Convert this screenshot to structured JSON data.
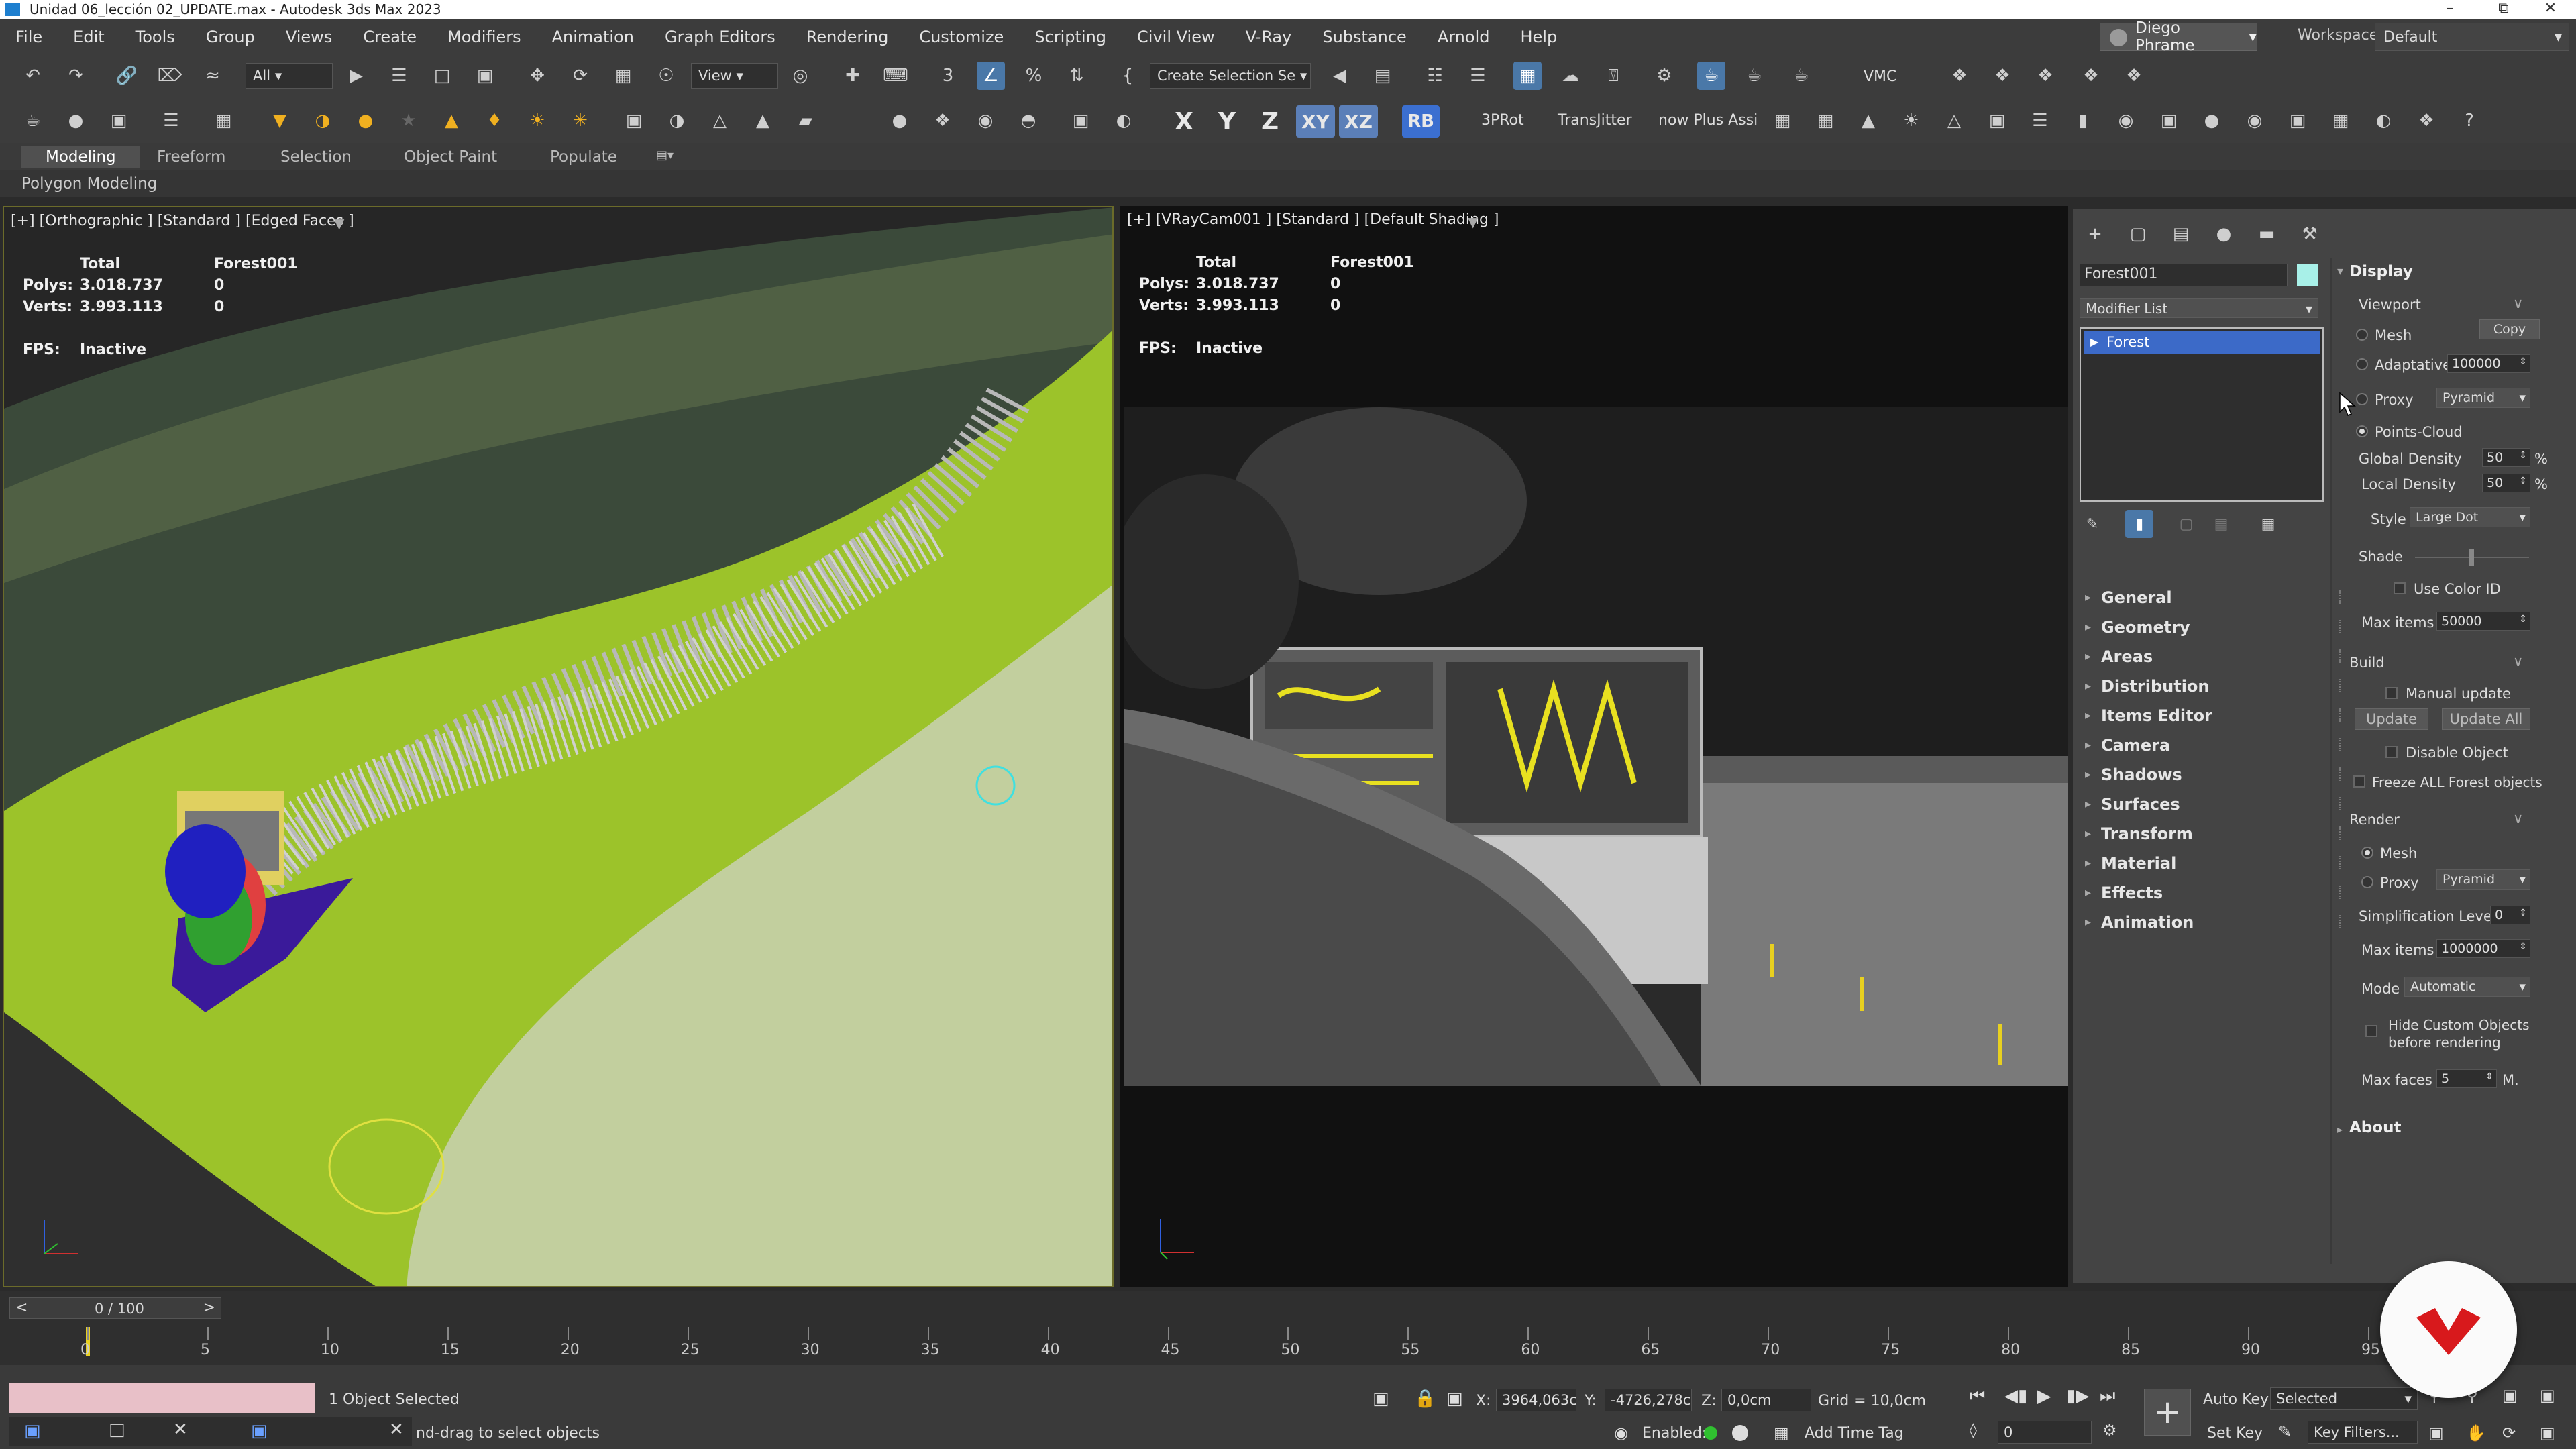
{
  "window": {
    "title": "Unidad 06_lección 02_UPDATE.max - Autodesk 3ds Max 2023"
  },
  "menu": [
    "File",
    "Edit",
    "Tools",
    "Group",
    "Views",
    "Create",
    "Modifiers",
    "Animation",
    "Graph Editors",
    "Rendering",
    "Customize",
    "Scripting",
    "Civil View",
    "V-Ray",
    "Substance",
    "Arnold",
    "Help"
  ],
  "user": {
    "name": "Diego Phrame"
  },
  "workspace": {
    "label": "Workspaces:",
    "value": "Default"
  },
  "toolbar1": {
    "filter": "All",
    "coord_system": "View",
    "selection_set": "Create Selection Se",
    "vmc": "VMC"
  },
  "toolbar2": {
    "axes": [
      "X",
      "Y",
      "Z",
      "XY",
      "XZ"
    ],
    "rb": "RB",
    "b3prot": "3PRot",
    "transitter": "TransJitter",
    "snow": "now Plus Assi"
  },
  "ribbon": {
    "tabs": [
      "Modeling",
      "Freeform",
      "Selection",
      "Object Paint",
      "Populate"
    ],
    "sub": "Polygon Modeling"
  },
  "viewport_left": {
    "label": "[+] [Orthographic ] [Standard ] [Edged Faces ]",
    "stats": {
      "head_total": "Total",
      "head_obj": "Forest001",
      "polys_label": "Polys:",
      "polys_total": "3.018.737",
      "polys_obj": "0",
      "verts_label": "Verts:",
      "verts_total": "3.993.113",
      "verts_obj": "0",
      "fps_label": "FPS:",
      "fps_value": "Inactive"
    }
  },
  "viewport_right": {
    "label": "[+] [VRayCam001 ] [Standard ] [Default Shading ]",
    "stats": {
      "head_total": "Total",
      "head_obj": "Forest001",
      "polys_label": "Polys:",
      "polys_total": "3.018.737",
      "polys_obj": "0",
      "verts_label": "Verts:",
      "verts_total": "3.993.113",
      "verts_obj": "0",
      "fps_label": "FPS:",
      "fps_value": "Inactive"
    }
  },
  "command_panel": {
    "object_name": "Forest001",
    "object_color": "#a8f0e8",
    "modifier_list": "Modifier List",
    "stack_item": "Forest",
    "rollouts": [
      "General",
      "Geometry",
      "Areas",
      "Distribution",
      "Items Editor",
      "Camera",
      "Shadows",
      "Surfaces",
      "Transform",
      "Material",
      "Effects",
      "Animation"
    ],
    "display": {
      "title": "Display",
      "viewport": "Viewport",
      "mesh": "Mesh",
      "copy": "Copy",
      "adaptative": "Adaptative",
      "adaptative_value": "100000",
      "proxy": "Proxy",
      "proxy_value": "Pyramid",
      "points_cloud": "Points-Cloud",
      "global_density": "Global Density",
      "global_density_value": "50",
      "pct": "%",
      "local_density": "Local Density",
      "local_density_value": "50",
      "style": "Style",
      "style_value": "Large Dot",
      "shade": "Shade",
      "use_color_id": "Use Color ID",
      "max_items": "Max items",
      "max_items_value": "50000",
      "build": "Build",
      "manual_update": "Manual update",
      "update": "Update",
      "update_all": "Update All",
      "disable_object": "Disable Object",
      "freeze_all": "Freeze ALL Forest objects",
      "render": "Render",
      "render_mesh": "Mesh",
      "render_proxy": "Proxy",
      "render_proxy_value": "Pyramid",
      "simplification": "Simplification Level",
      "simplification_value": "0",
      "render_max_items": "Max items",
      "render_max_items_value": "1000000",
      "mode": "Mode",
      "mode_value": "Automatic",
      "hide_custom": "Hide Custom Objects",
      "hide_custom2": "before rendering",
      "max_faces": "Max faces",
      "max_faces_value": "5",
      "max_faces_unit": "M.",
      "about": "About"
    }
  },
  "timeline": {
    "frame": "0 / 100",
    "ticks": [
      "0",
      "5",
      "10",
      "15",
      "20",
      "25",
      "30",
      "35",
      "40",
      "45",
      "50",
      "55",
      "60",
      "65",
      "70",
      "75",
      "80",
      "85",
      "90",
      "95"
    ]
  },
  "status": {
    "selected": "1 Object Selected",
    "prompt": "nd-drag to select objects",
    "x_label": "X:",
    "x_value": "3964,063c",
    "y_label": "Y:",
    "y_value": "-4726,278c",
    "z_label": "Z:",
    "z_value": "0,0cm",
    "grid": "Grid = 10,0cm",
    "enabled": "Enabled:",
    "add_time_tag": "Add Time Tag",
    "auto_key": "Auto Key",
    "set_key": "Set Key",
    "selected_drop": "Selected",
    "key_filters": "Key Filters...",
    "frame_field": "0"
  }
}
